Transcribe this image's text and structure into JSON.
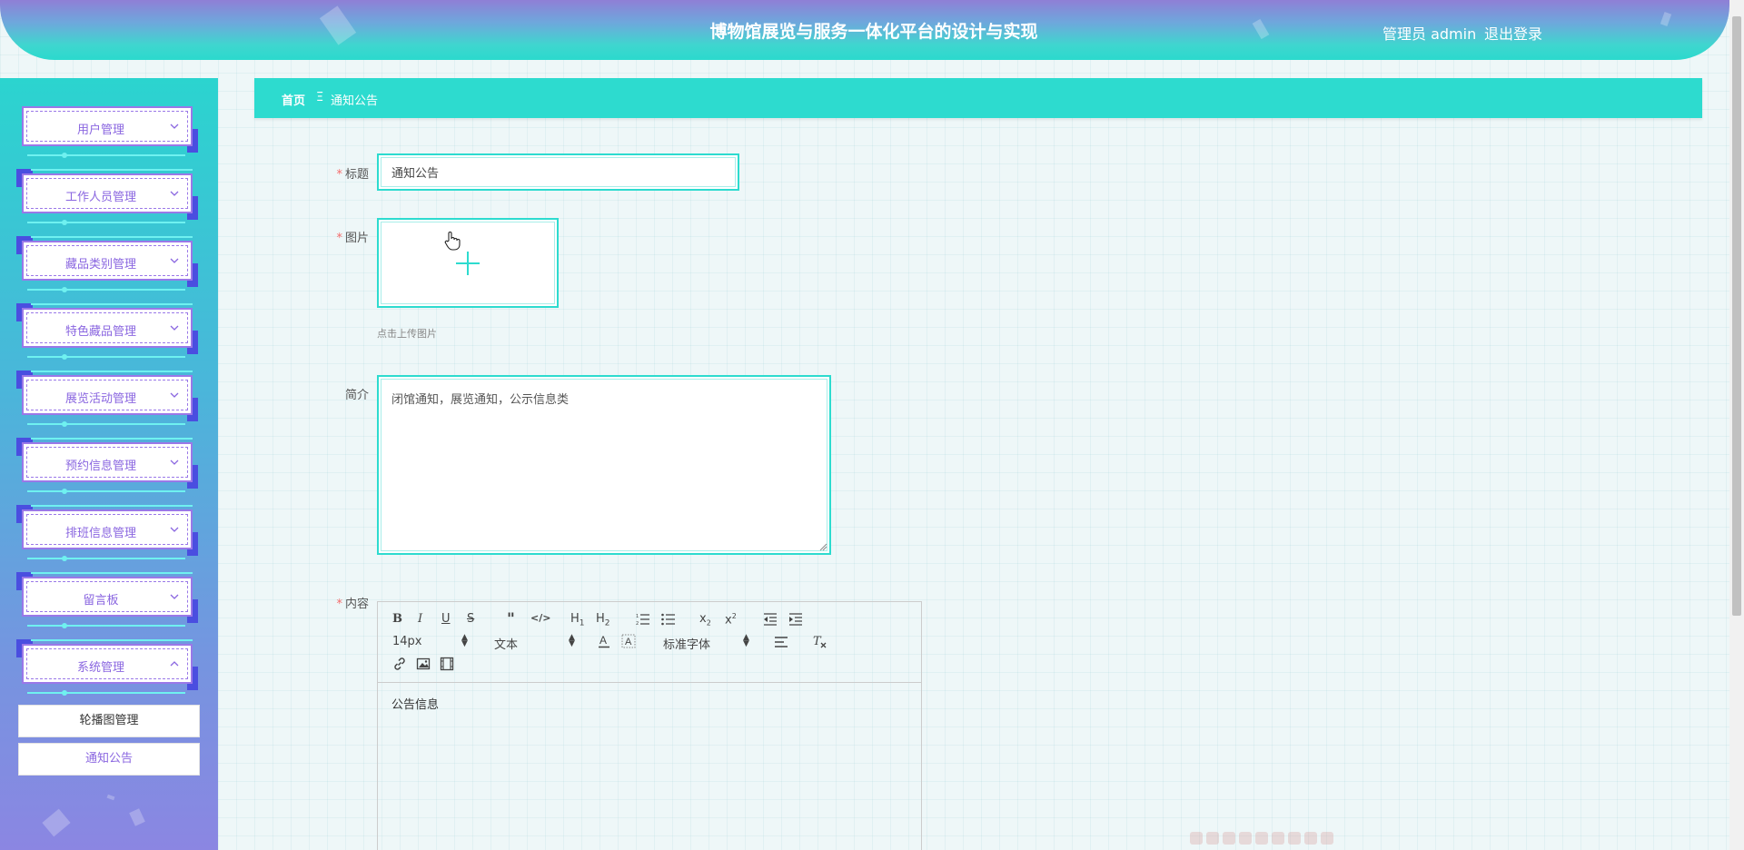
{
  "header": {
    "title": "博物馆展览与服务一体化平台的设计与实现",
    "user": "管理员 admin",
    "logout": "退出登录"
  },
  "sidebar": {
    "menus": [
      {
        "label": "用户管理",
        "expanded": false
      },
      {
        "label": "工作人员管理",
        "expanded": false
      },
      {
        "label": "藏品类别管理",
        "expanded": false
      },
      {
        "label": "特色藏品管理",
        "expanded": false
      },
      {
        "label": "展览活动管理",
        "expanded": false
      },
      {
        "label": "预约信息管理",
        "expanded": false
      },
      {
        "label": "排班信息管理",
        "expanded": false
      },
      {
        "label": "留言板",
        "expanded": false
      },
      {
        "label": "系统管理",
        "expanded": true
      }
    ],
    "submenus": [
      {
        "label": "轮播图管理",
        "color": "#333333"
      },
      {
        "label": "通知公告",
        "color": "#8a66e0"
      }
    ]
  },
  "breadcrumb": {
    "home": "首页",
    "separator": "Ξ",
    "current": "通知公告"
  },
  "form": {
    "title_label": "标题",
    "title_value": "通知公告",
    "image_label": "图片",
    "upload_hint": "点击上传图片",
    "summary_label": "简介",
    "summary_value": "闭馆通知，展览通知，公示信息类",
    "content_label": "内容",
    "required_mark": "*"
  },
  "editor": {
    "font_size": "14px",
    "paragraph": "文本",
    "font_family": "标准字体",
    "content": "公告信息"
  },
  "colors": {
    "accent": "#2ddbcf",
    "menu_text": "#8a66e0",
    "required": "#f56c6c"
  }
}
